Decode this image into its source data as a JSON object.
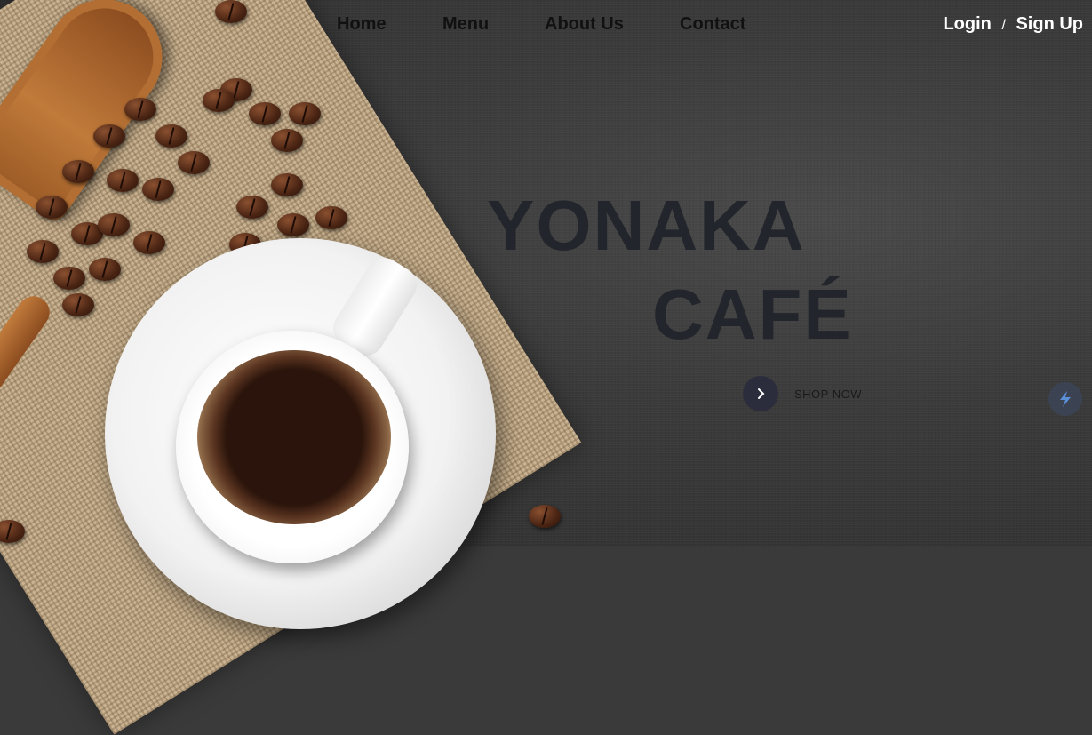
{
  "nav": {
    "links": [
      "Home",
      "Menu",
      "About Us",
      "Contact"
    ],
    "login": "Login",
    "separator": "/",
    "signup": "Sign Up"
  },
  "hero": {
    "title_line1": "YONAKA",
    "title_line2": "CAFÉ",
    "shop_label": "SHOP NOW",
    "shop_icon": "chevron-right-icon",
    "fab_icon": "lightning-icon"
  },
  "colors": {
    "title": "#22252b",
    "shop_button": "#2c2d3c",
    "nav_text": "#111111",
    "auth_text": "#ffffff"
  }
}
